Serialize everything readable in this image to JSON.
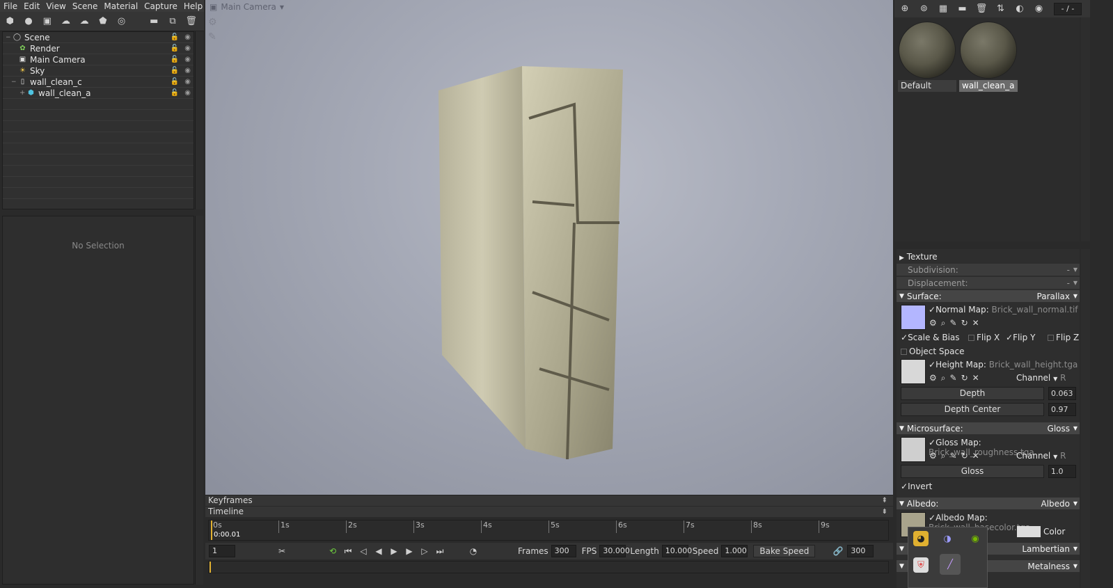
{
  "menu": [
    "File",
    "Edit",
    "View",
    "Scene",
    "Material",
    "Capture",
    "Help"
  ],
  "left_toolbar": [
    "mesh-icon",
    "light-icon",
    "camera-icon",
    "sky-icon",
    "fog-icon",
    "shadow-catcher-icon",
    "turntable-icon",
    "open-folder-icon",
    "duplicate-icon",
    "delete-icon"
  ],
  "scene_tree": {
    "items": [
      {
        "label": "Scene",
        "icon": "scene-icon"
      },
      {
        "label": "Render",
        "icon": "render-icon"
      },
      {
        "label": "Main Camera",
        "icon": "camera-icon"
      },
      {
        "label": "Sky",
        "icon": "sky-icon"
      },
      {
        "label": "wall_clean_c",
        "icon": "mesh-file-icon"
      },
      {
        "label": "wall_clean_a",
        "icon": "mesh-icon"
      }
    ]
  },
  "properties_empty": "No Selection",
  "viewport": {
    "camera": "Main Camera"
  },
  "bottom": {
    "keyframes": "Keyframes",
    "timeline": "Timeline",
    "ticks": [
      "0s",
      "1s",
      "2s",
      "3s",
      "4s",
      "5s",
      "6s",
      "7s",
      "8s",
      "9s"
    ],
    "time": "0:00.01",
    "current_frame": "1",
    "frames_label": "Frames",
    "frames_val": "300",
    "fps_label": "FPS",
    "fps_val": "30.000",
    "length_label": "Length",
    "length_val": "10.000",
    "speed_label": "Speed",
    "speed_val": "1.000",
    "bake_speed": "Bake Speed",
    "link_val": "300"
  },
  "right_toolbar": {
    "counter": "- / -"
  },
  "materials": [
    {
      "label": "Default",
      "selected": false
    },
    {
      "label": "wall_clean_a",
      "selected": true
    }
  ],
  "panel": {
    "texture": "Texture",
    "subdivision": "Subdivision:",
    "subdivision_val": "-",
    "displacement": "Displacement:",
    "displacement_val": "-",
    "surface": "Surface:",
    "surface_val": "Parallax",
    "normal_label": "Normal Map:",
    "normal_file": "Brick_wall_normal.tif",
    "scale_bias": "Scale & Bias",
    "flip_x": "Flip X",
    "flip_y": "Flip Y",
    "flip_z": "Flip Z",
    "object_space": "Object Space",
    "height_label": "Height Map:",
    "height_file": "Brick_wall_height.tga",
    "channel": "Channel",
    "channel_val": "R",
    "depth": "Depth",
    "depth_val": "0.063",
    "depth_center": "Depth Center",
    "depth_center_val": "0.97",
    "microsurface": "Microsurface:",
    "microsurface_val": "Gloss",
    "gloss_label": "Gloss Map:",
    "gloss_file": "Brick_wall_roughness.tga",
    "gloss": "Gloss",
    "gloss_val": "1.0",
    "invert": "Invert",
    "albedo": "Albedo:",
    "albedo_val": "Albedo",
    "albedo_label": "Albedo Map:",
    "albedo_file": "Brick_wall_basecolor.tga",
    "color": "Color",
    "lambertian": "Lambertian",
    "metalness": "Metalness"
  },
  "colors": {
    "accent": "#e0b030",
    "normal_swatch": "#b3b6ff",
    "panel": "#2e2e2e"
  }
}
